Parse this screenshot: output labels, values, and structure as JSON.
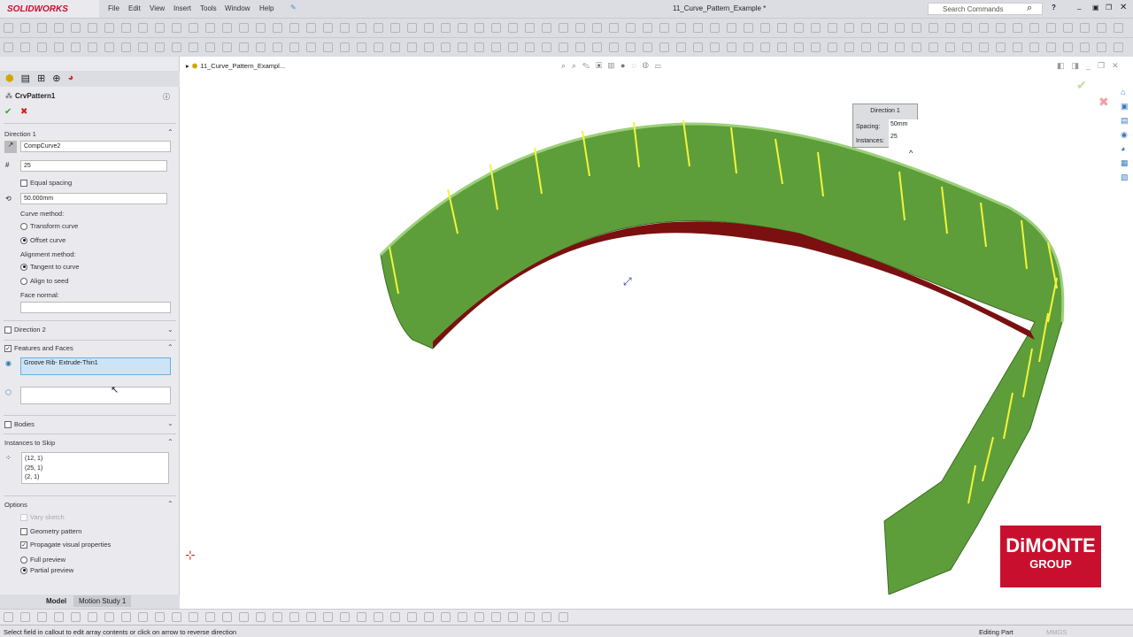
{
  "app": {
    "name": "SOLIDWORKS",
    "doc_title": "11_Curve_Pattern_Example *",
    "search_placeholder": "Search Commands"
  },
  "menu": [
    "File",
    "Edit",
    "View",
    "Insert",
    "Tools",
    "Window",
    "Help"
  ],
  "tree": {
    "root": "11_Curve_Pattern_Exampl..."
  },
  "feature": {
    "name": "CrvPattern1",
    "direction1": {
      "title": "Direction 1",
      "curve": "CompCurve2",
      "instances": "25",
      "equal_spacing": "Equal spacing",
      "spacing": "50.000mm",
      "curve_method_label": "Curve method:",
      "transform_curve": "Transform curve",
      "offset_curve": "Offset curve",
      "alignment_label": "Alignment method:",
      "tangent": "Tangent to curve",
      "align_seed": "Align to seed",
      "face_normal": "Face normal:"
    },
    "direction2": "Direction 2",
    "features_faces": {
      "title": "Features and Faces",
      "value": "Groove Rib- Extrude-Thin1"
    },
    "bodies": "Bodies",
    "skip": {
      "title": "Instances to Skip",
      "items": [
        "(12, 1)",
        "(25, 1)",
        "(2, 1)"
      ]
    },
    "options": {
      "title": "Options",
      "vary": "Vary sketch",
      "geometry": "Geometry pattern",
      "propagate": "Propagate visual properties",
      "full": "Full preview",
      "partial": "Partial preview"
    }
  },
  "callout": {
    "title": "Direction 1",
    "spacing_label": "Spacing:",
    "spacing": "50mm",
    "instances_label": "Instances:",
    "instances": "25"
  },
  "tabs": [
    "Model",
    "Motion Study 1"
  ],
  "status": {
    "message": "Select field in callout to edit array contents or click on arrow to reverse direction",
    "mode": "Editing Part",
    "units": "MMGS"
  },
  "watermark": {
    "line1": "DiMONTE",
    "line2": "GROUP"
  },
  "colors": {
    "model": "#5e9e3a",
    "rib": "#f4f43a",
    "brand": "#c8102e"
  }
}
